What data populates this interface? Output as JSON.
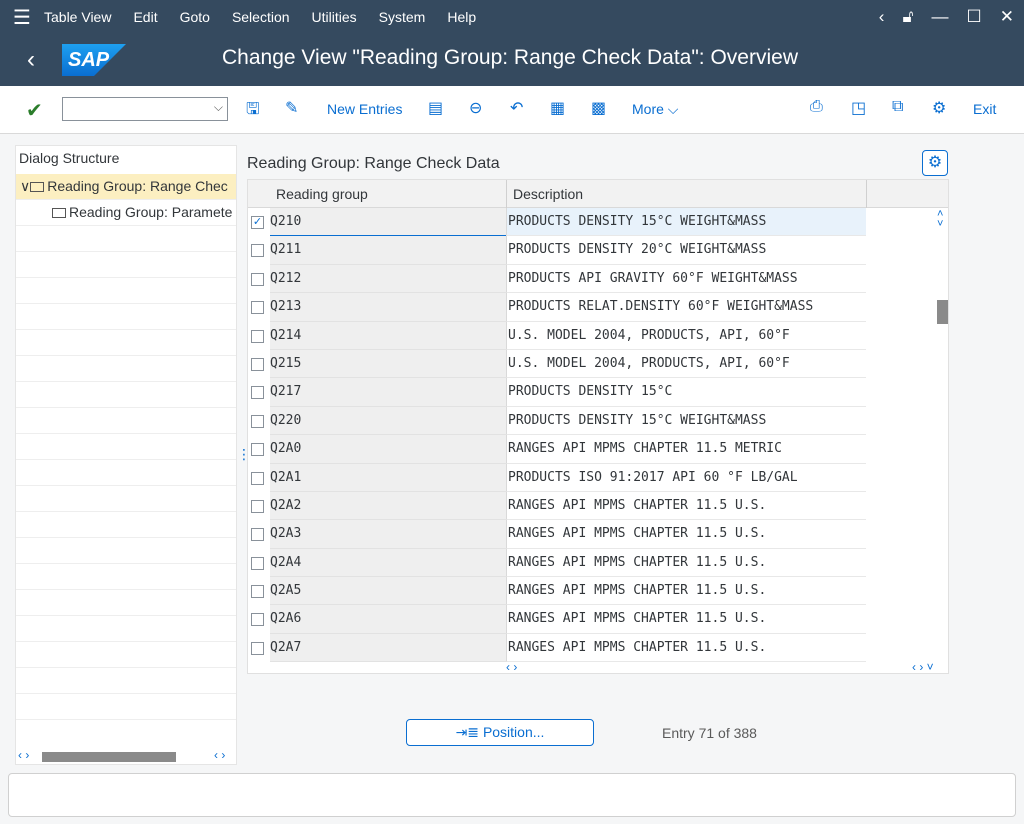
{
  "menu": [
    "Table View",
    "Edit",
    "Goto",
    "Selection",
    "Utilities",
    "System",
    "Help"
  ],
  "title": "Change View \"Reading Group: Range Check Data\": Overview",
  "logo": "SAP",
  "toolbar": {
    "new_entries": "New Entries",
    "more": "More",
    "exit": "Exit"
  },
  "left": {
    "header": "Dialog Structure",
    "items": [
      {
        "label": "Reading Group: Range Chec"
      },
      {
        "label": "Reading Group: Paramete"
      }
    ]
  },
  "main": {
    "title": "Reading Group: Range Check Data",
    "columns": [
      "Reading group",
      "Description"
    ],
    "rows": [
      {
        "group": "Q210",
        "desc": "PRODUCTS DENSITY 15°C WEIGHT&MASS",
        "checked": true
      },
      {
        "group": "Q211",
        "desc": "PRODUCTS DENSITY 20°C WEIGHT&MASS"
      },
      {
        "group": "Q212",
        "desc": "PRODUCTS API GRAVITY 60°F WEIGHT&MASS"
      },
      {
        "group": "Q213",
        "desc": "PRODUCTS RELAT.DENSITY 60°F WEIGHT&MASS"
      },
      {
        "group": "Q214",
        "desc": "U.S. MODEL 2004, PRODUCTS, API, 60°F"
      },
      {
        "group": "Q215",
        "desc": "U.S. MODEL 2004, PRODUCTS, API, 60°F"
      },
      {
        "group": "Q217",
        "desc": "PRODUCTS DENSITY 15°C"
      },
      {
        "group": "Q220",
        "desc": "PRODUCTS DENSITY 15°C WEIGHT&MASS"
      },
      {
        "group": "Q2A0",
        "desc": "RANGES API MPMS CHAPTER 11.5 METRIC"
      },
      {
        "group": "Q2A1",
        "desc": "PRODUCTS ISO 91:2017 API 60 °F LB/GAL"
      },
      {
        "group": "Q2A2",
        "desc": "RANGES API MPMS CHAPTER 11.5 U.S."
      },
      {
        "group": "Q2A3",
        "desc": "RANGES API MPMS CHAPTER 11.5 U.S."
      },
      {
        "group": "Q2A4",
        "desc": "RANGES API MPMS CHAPTER 11.5 U.S."
      },
      {
        "group": "Q2A5",
        "desc": "RANGES API MPMS CHAPTER 11.5 U.S."
      },
      {
        "group": "Q2A6",
        "desc": "RANGES API MPMS CHAPTER 11.5 U.S."
      },
      {
        "group": "Q2A7",
        "desc": "RANGES API MPMS CHAPTER 11.5 U.S."
      }
    ]
  },
  "position_button": "Position...",
  "entry_info": "Entry 71 of 388"
}
